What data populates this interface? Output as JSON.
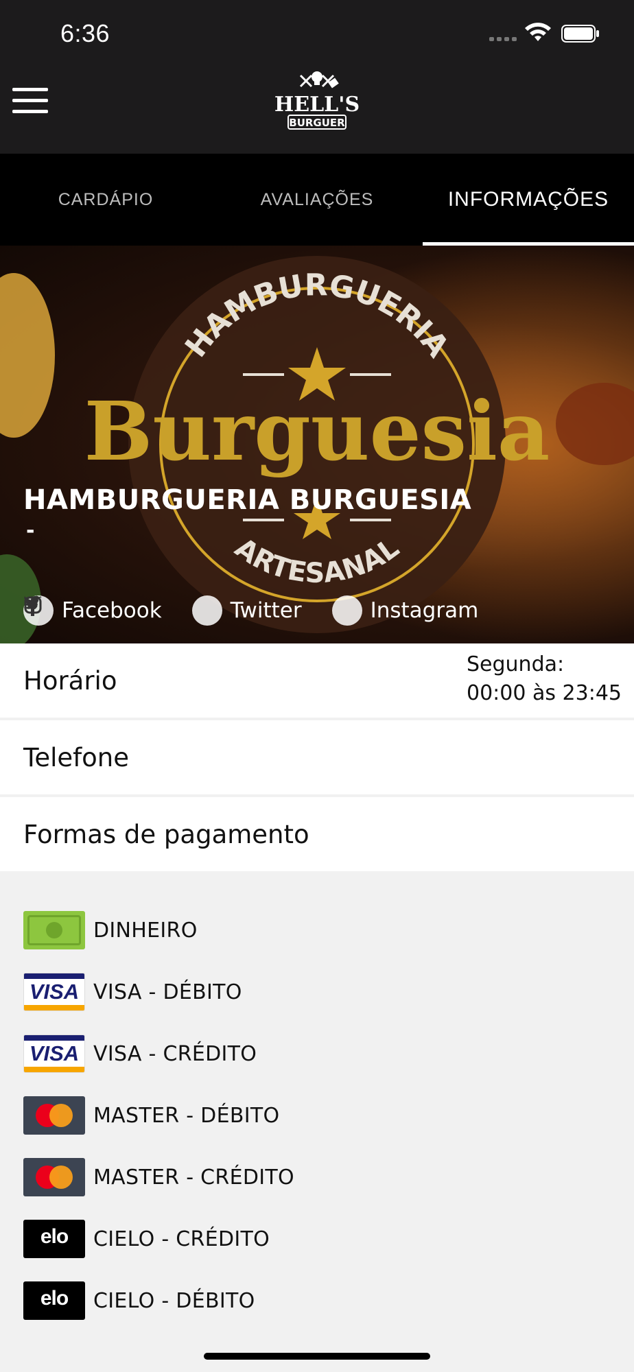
{
  "status_bar": {
    "time": "6:36"
  },
  "header": {
    "logo_alt": "HELL'S BURGUER"
  },
  "tabs": [
    {
      "label": "CARDÁPIO",
      "active": false
    },
    {
      "label": "AVALIAÇÕES",
      "active": false
    },
    {
      "label": "INFORMAÇÕES",
      "active": true
    }
  ],
  "hero": {
    "title": "HAMBURGUERIA BURGUESIA",
    "subtitle": "-",
    "background_logo": {
      "top": "HAMBURGUERIA",
      "main": "Burguesia",
      "bottom": "ARTESANAL"
    },
    "socials": [
      {
        "label": "Facebook",
        "icon": "facebook-icon"
      },
      {
        "label": "Twitter",
        "icon": "twitter-icon"
      },
      {
        "label": "Instagram",
        "icon": "instagram-icon"
      }
    ]
  },
  "info": {
    "horario_label": "Horário",
    "horario_day": "Segunda:",
    "horario_hours": "00:00 às 23:45",
    "telefone_label": "Telefone",
    "pagamento_label": "Formas de pagamento"
  },
  "payments": [
    {
      "name": "DINHEIRO",
      "type": "cash"
    },
    {
      "name": "VISA - DÉBITO",
      "type": "visa"
    },
    {
      "name": "VISA - CRÉDITO",
      "type": "visa"
    },
    {
      "name": "MASTER - DÉBITO",
      "type": "master"
    },
    {
      "name": "MASTER - CRÉDITO",
      "type": "master"
    },
    {
      "name": "CIELO - CRÉDITO",
      "type": "elo"
    },
    {
      "name": "CIELO - DÉBITO",
      "type": "elo"
    }
  ],
  "card_texts": {
    "visa": "VISA",
    "elo": "elo"
  },
  "colors": {
    "header_bg": "#1c1b1c",
    "tabs_bg": "#000000",
    "gold": "#d4a52a",
    "list_bg": "#f1f1f1"
  }
}
